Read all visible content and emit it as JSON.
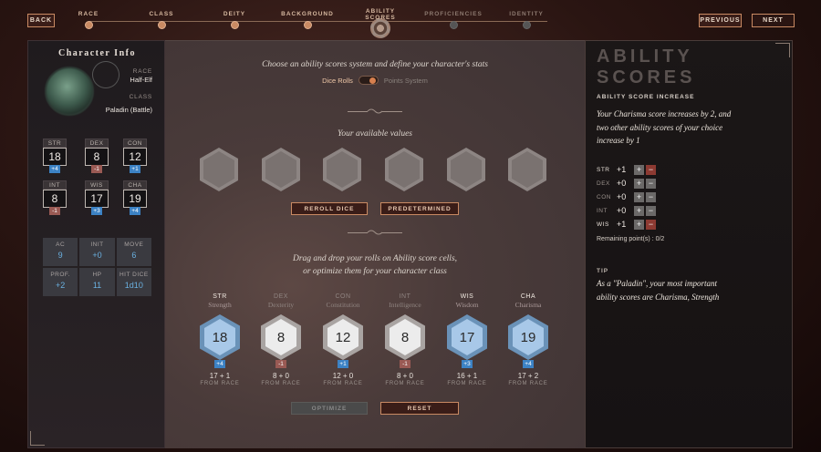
{
  "nav": {
    "back": "BACK",
    "previous": "PREVIOUS",
    "next": "NEXT",
    "steps": [
      {
        "label": "RACE",
        "state": "done"
      },
      {
        "label": "CLASS",
        "state": "done"
      },
      {
        "label": "DEITY",
        "state": "done"
      },
      {
        "label": "BACKGROUND",
        "state": "done"
      },
      {
        "label": "ABILITY SCORES",
        "state": "current"
      },
      {
        "label": "PROFICIENCIES",
        "state": "future"
      },
      {
        "label": "IDENTITY",
        "state": "future"
      }
    ]
  },
  "character": {
    "title": "Character Info",
    "race_label": "RACE",
    "race": "Half-Elf",
    "class_label": "CLASS",
    "class": "Paladin (Battle)",
    "stats": [
      {
        "abbr": "STR",
        "value": "18",
        "mod": "+4",
        "sign": "pos"
      },
      {
        "abbr": "DEX",
        "value": "8",
        "mod": "-1",
        "sign": "neg"
      },
      {
        "abbr": "CON",
        "value": "12",
        "mod": "+1",
        "sign": "pos"
      },
      {
        "abbr": "INT",
        "value": "8",
        "mod": "-1",
        "sign": "neg"
      },
      {
        "abbr": "WIS",
        "value": "17",
        "mod": "+3",
        "sign": "pos"
      },
      {
        "abbr": "CHA",
        "value": "19",
        "mod": "+4",
        "sign": "pos"
      }
    ],
    "derived": [
      {
        "label": "AC",
        "value": "9"
      },
      {
        "label": "INIT",
        "value": "+0"
      },
      {
        "label": "MOVE",
        "value": "6"
      },
      {
        "label": "PROF.",
        "value": "+2"
      },
      {
        "label": "HP",
        "value": "11"
      },
      {
        "label": "HIT DICE",
        "value": "1d10"
      }
    ]
  },
  "center": {
    "heading": "Choose an ability scores system and define your character's stats",
    "option_dice": "Dice Rolls",
    "option_points": "Points System",
    "values_title": "Your available values",
    "reroll": "REROLL DICE",
    "predetermined": "PREDETERMINED",
    "instruction_1": "Drag and drop your rolls on Ability score cells,",
    "instruction_2": "or optimize them for your character class",
    "abilities": [
      {
        "abbr": "STR",
        "name": "Strength",
        "score": "18",
        "mod": "+4",
        "sign": "pos",
        "calc": "17 + 1",
        "from": "FROM RACE",
        "highlight": true
      },
      {
        "abbr": "DEX",
        "name": "Dexterity",
        "score": "8",
        "mod": "-1",
        "sign": "neg",
        "calc": "8 + 0",
        "from": "FROM RACE",
        "highlight": false
      },
      {
        "abbr": "CON",
        "name": "Constitution",
        "score": "12",
        "mod": "+1",
        "sign": "pos",
        "calc": "12 + 0",
        "from": "FROM RACE",
        "highlight": false
      },
      {
        "abbr": "INT",
        "name": "Intelligence",
        "score": "8",
        "mod": "-1",
        "sign": "neg",
        "calc": "8 + 0",
        "from": "FROM RACE",
        "highlight": false
      },
      {
        "abbr": "WIS",
        "name": "Wisdom",
        "score": "17",
        "mod": "+3",
        "sign": "pos",
        "calc": "16 + 1",
        "from": "FROM RACE",
        "highlight": true
      },
      {
        "abbr": "CHA",
        "name": "Charisma",
        "score": "19",
        "mod": "+4",
        "sign": "pos",
        "calc": "17 + 2",
        "from": "FROM RACE",
        "highlight": true
      }
    ],
    "optimize": "OPTIMIZE",
    "reset": "RESET"
  },
  "info": {
    "title_1": "ABILITY",
    "title_2": "SCORES",
    "increase_heading": "ABILITY SCORE INCREASE",
    "increase_text": "Your Charisma score increases by 2, and two other ability scores of your choice increase by 1",
    "increases": [
      {
        "abbr": "STR",
        "value": "+1",
        "active": true
      },
      {
        "abbr": "DEX",
        "value": "+0",
        "active": false
      },
      {
        "abbr": "CON",
        "value": "+0",
        "active": false
      },
      {
        "abbr": "INT",
        "value": "+0",
        "active": false
      },
      {
        "abbr": "WIS",
        "value": "+1",
        "active": true
      }
    ],
    "remaining": "Remaining point(s) : 0/2",
    "tip_heading": "TIP",
    "tip_text": "As a \"Paladin\", your most important ability scores are Charisma, Strength",
    "plus": "+",
    "minus": "−"
  }
}
